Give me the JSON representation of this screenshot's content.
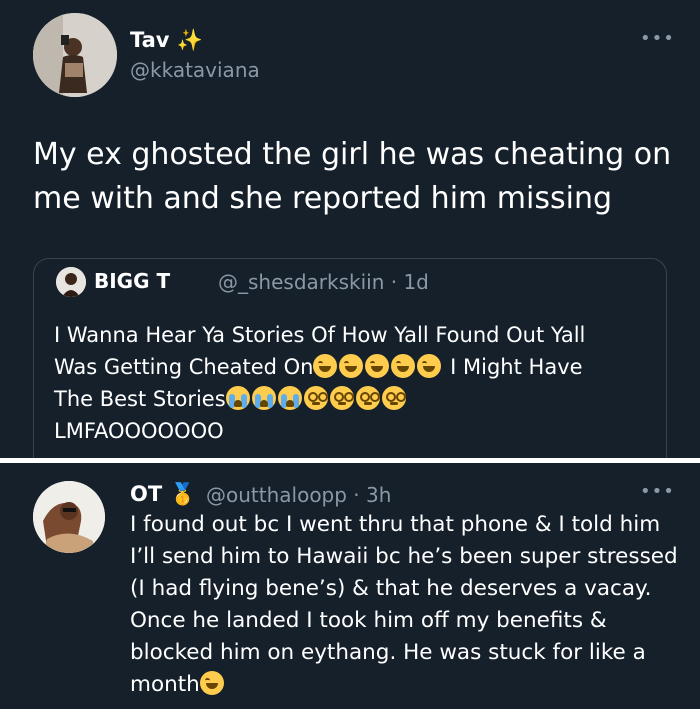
{
  "main_tweet": {
    "name": "Tav",
    "name_emoji": "✨",
    "handle": "@kkataviana",
    "text": "My ex ghosted the girl he was cheating on me with and she reported him missing",
    "more_icon": "more-dots-icon"
  },
  "quoted_tweet": {
    "name": "BIGG T",
    "handle": "@_shesdarkskiin · 1d",
    "line1": "I Wanna Hear Ya Stories Of How Yall Found Out Yall",
    "line2_start": "Was Getting Cheated On",
    "line2_end": " I Might Have",
    "line3_start": "The Best Stories",
    "line4": "LMFAOOOOOOO"
  },
  "reply_tweet": {
    "name": "OT",
    "name_emoji": "🥇",
    "handle": "@outthaloopp · 3h",
    "text": "I found out bc I went thru that phone & I told him I’ll send him to Hawaii bc he’s been super stressed (I had flying bene’s) & that he deserves a vacay. Once he landed I took him off my benefits & blocked him on eythang. He was stuck for like a month",
    "more_icon": "more-dots-icon"
  },
  "colors": {
    "background": "#15202b",
    "secondary_text": "#8b98a5",
    "divider": "#ffffff"
  }
}
